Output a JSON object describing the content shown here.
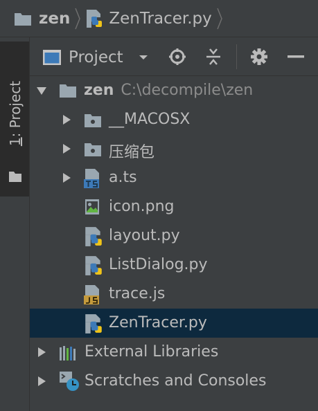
{
  "breadcrumb": {
    "project": "zen",
    "file": "ZenTracer.py"
  },
  "side_tab": {
    "number": "1",
    "label": ": Project"
  },
  "toolbar": {
    "view_label": "Project"
  },
  "tree": {
    "root": {
      "name": "zen",
      "path": "C:\\decompile\\zen"
    },
    "items": [
      {
        "label": "__MACOSX"
      },
      {
        "label": "压缩包"
      },
      {
        "label": "a.ts"
      },
      {
        "label": "icon.png"
      },
      {
        "label": "layout.py"
      },
      {
        "label": "ListDialog.py"
      },
      {
        "label": "trace.js"
      },
      {
        "label": "ZenTracer.py"
      }
    ],
    "external_libraries": "External Libraries",
    "scratches": "Scratches and Consoles"
  },
  "colors": {
    "panel_bg": "#3c3f41",
    "selection": "#0d293e",
    "text": "#bbbbbb",
    "path_text": "#8c8c8c",
    "folder": "#9aa7b0"
  }
}
